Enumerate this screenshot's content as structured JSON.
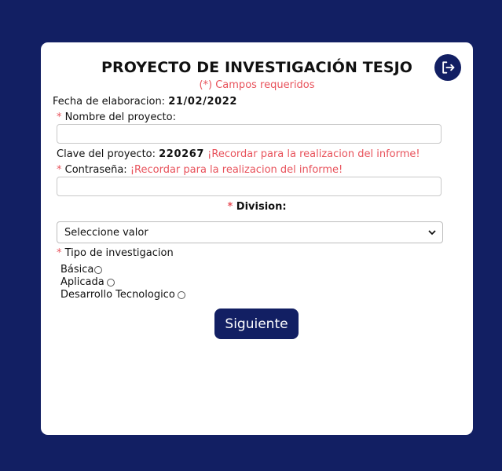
{
  "header": {
    "title": "PROYECTO DE INVESTIGACIÓN TESJO",
    "required_note": "(*) Campos requeridos"
  },
  "icons": {
    "logout": "logout-icon"
  },
  "form": {
    "fecha_label": "Fecha de elaboracion:",
    "fecha_value": "21/02/2022",
    "required_mark": "*",
    "nombre_label": "Nombre del proyecto:",
    "nombre_value": "",
    "clave_label": "Clave del proyecto:",
    "clave_value": "220267",
    "clave_reminder": "¡Recordar para la realizacion del informe!",
    "password_label": "Contraseña:",
    "password_reminder": "¡Recordar para la realizacion del informe!",
    "password_value": "",
    "division_label": "Division:",
    "division_selected": "Seleccione valor",
    "tipo_label": "Tipo de investigacion",
    "tipo_options": [
      "Básica",
      "Aplicada",
      "Desarrollo Tecnologico"
    ],
    "submit_label": "Siguiente"
  },
  "colors": {
    "accent": "#121f63",
    "required": "#e8525b"
  }
}
